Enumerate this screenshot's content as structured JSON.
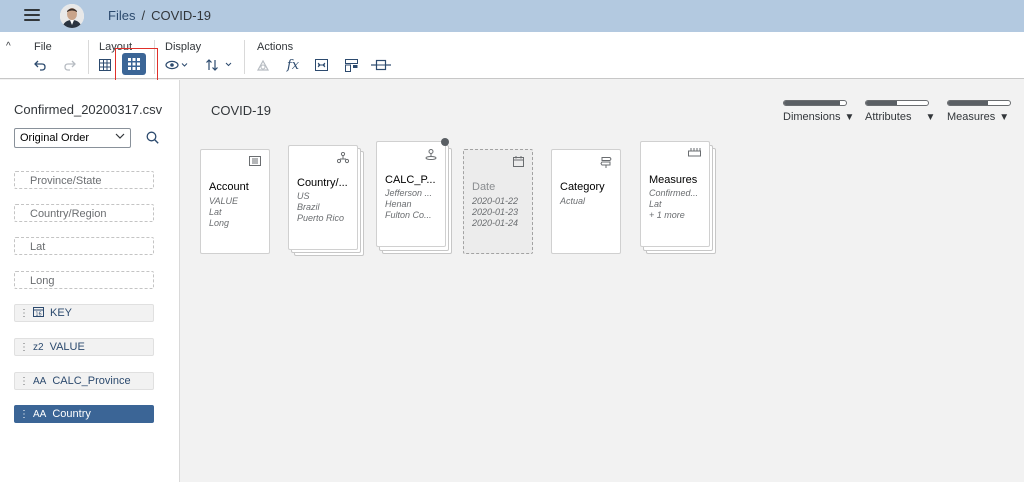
{
  "shell": {
    "breadcrumb_root": "Files",
    "breadcrumb_sep": "/",
    "breadcrumb_current": "COVID-19"
  },
  "toolbar": {
    "groups": {
      "file": "File",
      "layout": "Layout",
      "display": "Display",
      "actions": "Actions"
    },
    "actions_fx": "fx"
  },
  "left": {
    "filename": "Confirmed_20200317.csv",
    "sort_select": "Original Order",
    "fields": [
      "Province/State",
      "Country/Region",
      "Lat",
      "Long"
    ],
    "tokens": [
      {
        "icon": "calendar-icon",
        "label": "KEY"
      },
      {
        "icon_text": "z2",
        "label": "VALUE"
      },
      {
        "icon_text": "AA",
        "label": "CALC_Province"
      },
      {
        "icon_text": "AA",
        "label": "Country"
      }
    ]
  },
  "canvas": {
    "title": "COVID-19",
    "filters": [
      {
        "label": "Dimensions",
        "level": 0.9
      },
      {
        "label": "Attributes",
        "level": 0.5
      },
      {
        "label": "Measures",
        "level": 0.65
      }
    ],
    "cards": [
      {
        "title": "Account",
        "lines": [
          "VALUE",
          "Lat",
          "Long"
        ]
      },
      {
        "title": "Country/...",
        "lines": [
          "US",
          "Brazil",
          "Puerto Rico"
        ]
      },
      {
        "title": "CALC_P...",
        "lines": [
          "Jefferson ...",
          "Henan",
          "Fulton Co..."
        ]
      },
      {
        "title": "Date",
        "lines": [
          "2020-01-22",
          "2020-01-23",
          "2020-01-24"
        ]
      },
      {
        "title": "Category",
        "lines": [
          "Actual"
        ]
      },
      {
        "title": "Measures",
        "lines": [
          "Confirmed...",
          "Lat",
          "+ 1 more"
        ]
      }
    ]
  },
  "colors": {
    "shell_bg": "#b3c9e0",
    "accent": "#3b6596",
    "highlight": "#e0302a"
  }
}
